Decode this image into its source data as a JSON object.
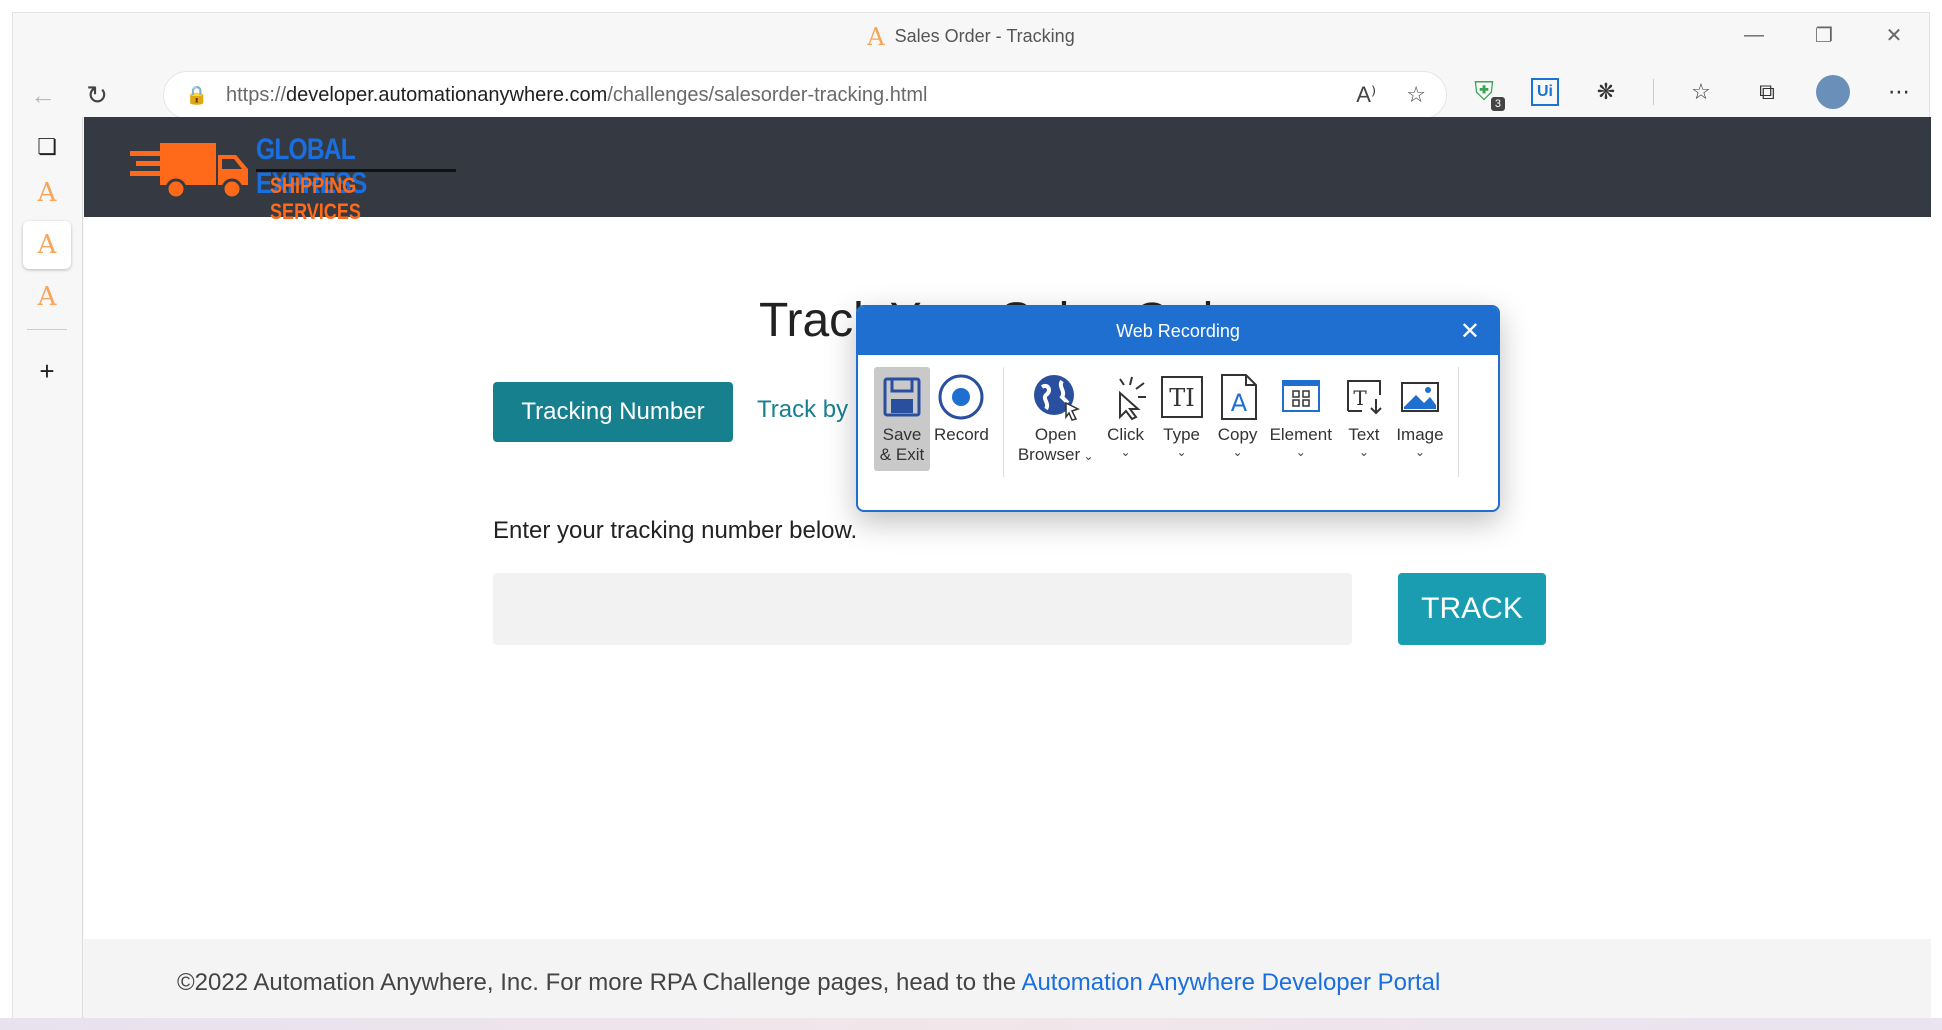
{
  "window": {
    "title": "Sales Order - Tracking"
  },
  "address": {
    "url_scheme": "https://",
    "url_domain": "developer.automationanywhere.com",
    "url_path": "/challenges/salesorder-tracking.html"
  },
  "extensions": {
    "badge_count": "3",
    "ui_label": "Ui"
  },
  "site": {
    "logo_line1": "GLOBAL EXPRESS",
    "logo_line2": "SHIPPING SERVICES",
    "title": "Track Your Sales Order",
    "tab_tracking_number": "Tracking Number",
    "tab_track_by": "Track by",
    "instruction": "Enter your tracking number below.",
    "track_input_value": "",
    "track_button": "TRACK",
    "footer_text": "©2022 Automation Anywhere, Inc. For more RPA Challenge pages, head to the",
    "footer_link": "Automation Anywhere Developer Portal"
  },
  "recorder": {
    "title": "Web Recording",
    "tools": [
      {
        "line1": "Save",
        "line2": "& Exit",
        "icon": "save-icon"
      },
      {
        "line1": "Record",
        "line2": "",
        "icon": "record-icon"
      },
      {
        "line1": "Open",
        "line2": "Browser",
        "icon": "globe-icon"
      },
      {
        "line1": "Click",
        "line2": "",
        "icon": "click-icon"
      },
      {
        "line1": "Type",
        "line2": "",
        "icon": "type-icon"
      },
      {
        "line1": "Copy",
        "line2": "",
        "icon": "copy-icon"
      },
      {
        "line1": "Element",
        "line2": "",
        "icon": "element-icon"
      },
      {
        "line1": "Text",
        "line2": "",
        "icon": "text-icon"
      },
      {
        "line1": "Image",
        "line2": "",
        "icon": "image-icon"
      }
    ]
  },
  "colors": {
    "accent": "#17808f",
    "track_button": "#1a9db0",
    "recorder_blue": "#1e6fd0",
    "header": "#353a42"
  }
}
